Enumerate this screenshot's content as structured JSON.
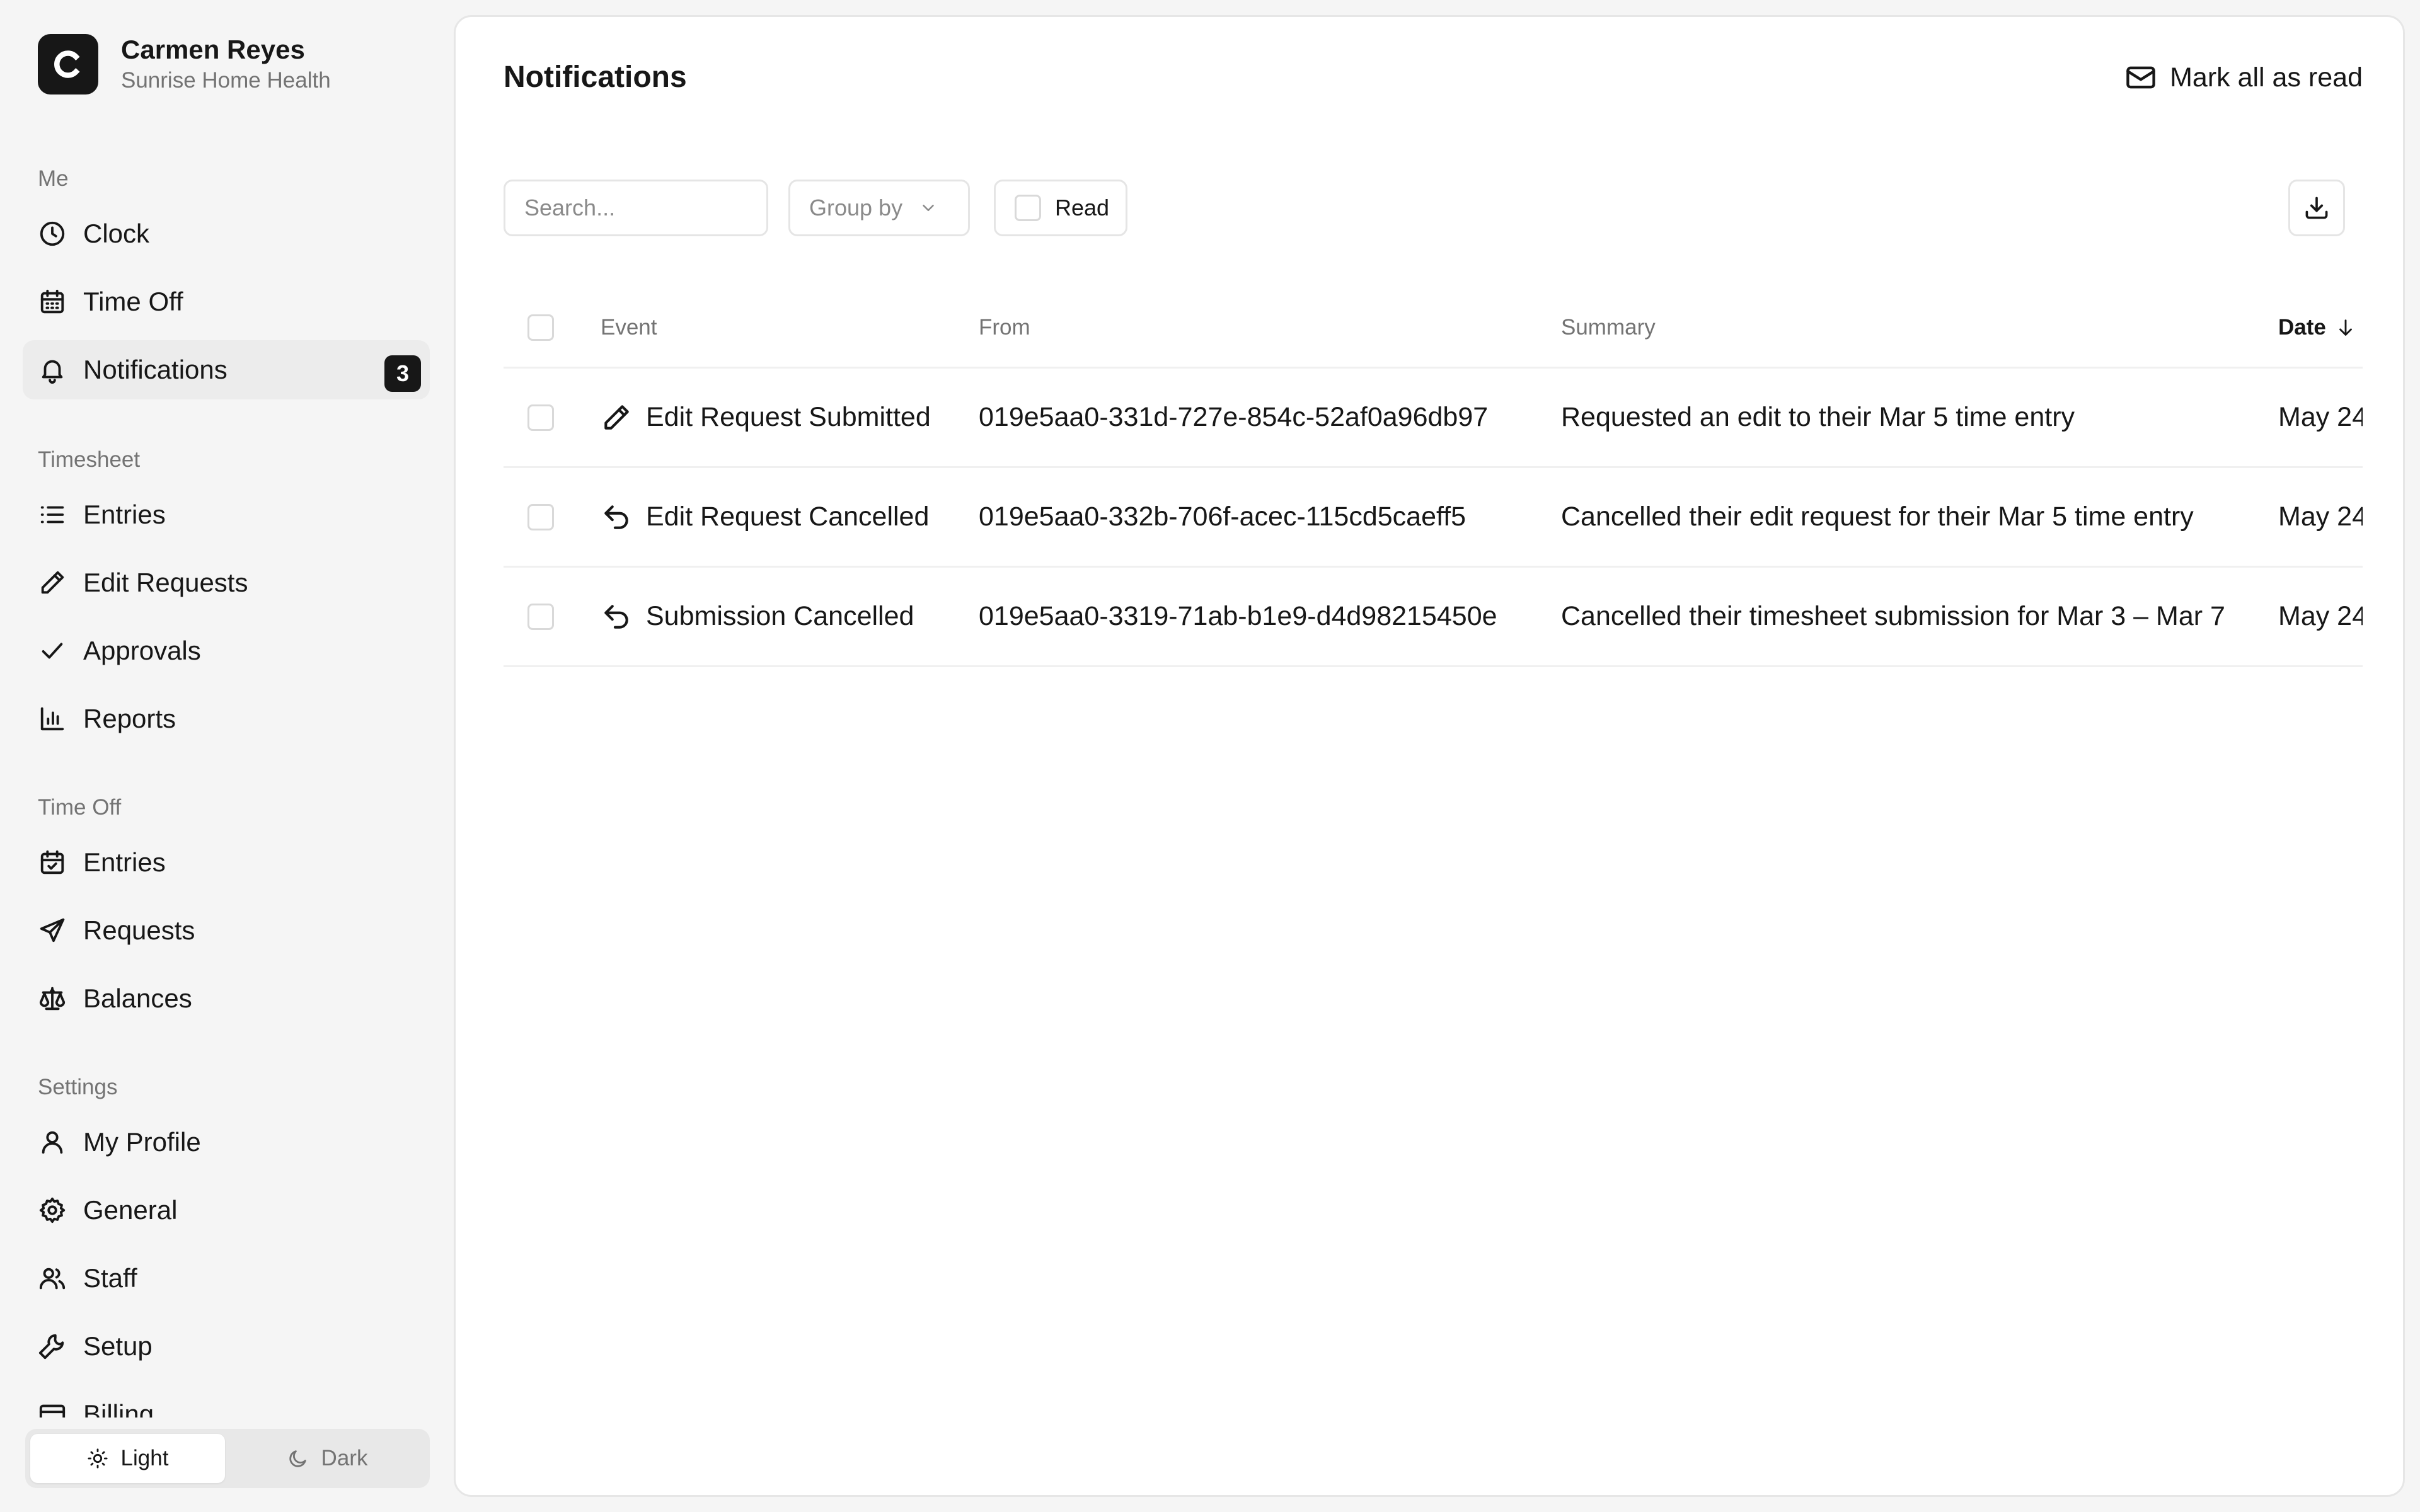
{
  "user": {
    "initial": "C",
    "name": "Carmen Reyes",
    "organization": "Sunrise Home Health"
  },
  "sidebar": {
    "groups": [
      {
        "label": "Me",
        "items": [
          {
            "label": "Clock",
            "icon": "clock-icon"
          },
          {
            "label": "Time Off",
            "icon": "calendar-icon"
          },
          {
            "label": "Notifications",
            "icon": "bell-icon",
            "badge": "3",
            "active": true
          }
        ]
      },
      {
        "label": "Timesheet",
        "items": [
          {
            "label": "Entries",
            "icon": "list-icon"
          },
          {
            "label": "Edit Requests",
            "icon": "pencil-icon"
          },
          {
            "label": "Approvals",
            "icon": "check-icon"
          },
          {
            "label": "Reports",
            "icon": "bar-chart-icon"
          }
        ]
      },
      {
        "label": "Time Off",
        "items": [
          {
            "label": "Entries",
            "icon": "calendar-check-icon"
          },
          {
            "label": "Requests",
            "icon": "send-icon"
          },
          {
            "label": "Balances",
            "icon": "scale-icon"
          }
        ]
      },
      {
        "label": "Settings",
        "items": [
          {
            "label": "My Profile",
            "icon": "user-icon"
          },
          {
            "label": "General",
            "icon": "gear-icon"
          },
          {
            "label": "Staff",
            "icon": "users-icon"
          },
          {
            "label": "Setup",
            "icon": "wrench-icon"
          },
          {
            "label": "Billing",
            "icon": "credit-card-icon"
          }
        ]
      }
    ]
  },
  "theme": {
    "light_label": "Light",
    "dark_label": "Dark",
    "selected": "light"
  },
  "page": {
    "title": "Notifications",
    "mark_all_label": "Mark all as read"
  },
  "toolbar": {
    "search_placeholder": "Search...",
    "group_by_label": "Group by",
    "read_filter_label": "Read",
    "read_filter_checked": false
  },
  "table": {
    "columns": {
      "event": "Event",
      "from": "From",
      "summary": "Summary",
      "date": "Date"
    },
    "sort": {
      "column": "date",
      "direction": "descending"
    },
    "rows": [
      {
        "icon": "pencil-icon",
        "event": "Edit Request Submitted",
        "from": "019e5aa0-331d-727e-854c-52af0a96db97",
        "summary": "Requested an edit to their Mar 5 time entry",
        "date": "May 24"
      },
      {
        "icon": "undo-icon",
        "event": "Edit Request Cancelled",
        "from": "019e5aa0-332b-706f-acec-115cd5caeff5",
        "summary": "Cancelled their edit request for their Mar 5 time entry",
        "date": "May 24"
      },
      {
        "icon": "undo-icon",
        "event": "Submission Cancelled",
        "from": "019e5aa0-3319-71ab-b1e9-d4d98215450e",
        "summary": "Cancelled their timesheet submission for Mar 3 – Mar 7",
        "date": "May 24"
      }
    ]
  },
  "colors": {
    "accent": "#171717",
    "active_nav_bg": "#ececec",
    "page_bg": "#f5f5f5",
    "muted_text": "#737373"
  }
}
